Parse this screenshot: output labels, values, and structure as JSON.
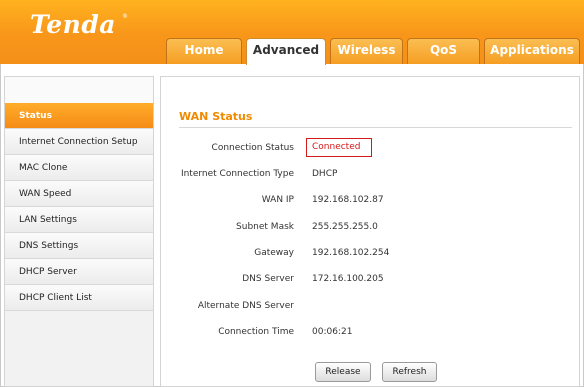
{
  "brand": {
    "logo": "Tenda",
    "reg_mark": "®"
  },
  "tabs": [
    {
      "label": "Home",
      "active": false
    },
    {
      "label": "Advanced",
      "active": true
    },
    {
      "label": "Wireless",
      "active": false
    },
    {
      "label": "QoS",
      "active": false
    },
    {
      "label": "Applications",
      "active": false
    }
  ],
  "sidebar": {
    "items": [
      {
        "label": "Status",
        "active": true
      },
      {
        "label": "Internet Connection Setup",
        "active": false
      },
      {
        "label": "MAC Clone",
        "active": false
      },
      {
        "label": "WAN Speed",
        "active": false
      },
      {
        "label": "LAN Settings",
        "active": false
      },
      {
        "label": "DNS Settings",
        "active": false
      },
      {
        "label": "DHCP Server",
        "active": false
      },
      {
        "label": "DHCP Client List",
        "active": false
      }
    ]
  },
  "wan_status": {
    "title": "WAN Status",
    "rows": [
      {
        "label": "Connection Status",
        "value": "Connected"
      },
      {
        "label": "Internet Connection Type",
        "value": "DHCP"
      },
      {
        "label": "WAN IP",
        "value": "192.168.102.87"
      },
      {
        "label": "Subnet Mask",
        "value": "255.255.255.0"
      },
      {
        "label": "Gateway",
        "value": "192.168.102.254"
      },
      {
        "label": "DNS Server",
        "value": "172.16.100.205"
      },
      {
        "label": "Alternate DNS Server",
        "value": ""
      },
      {
        "label": "Connection Time",
        "value": "00:06:21"
      }
    ]
  },
  "buttons": {
    "release": "Release",
    "refresh": "Refresh"
  },
  "colors": {
    "accent": "#f49018",
    "status_connected": "#d21a1a",
    "section_title": "#f08a00"
  }
}
